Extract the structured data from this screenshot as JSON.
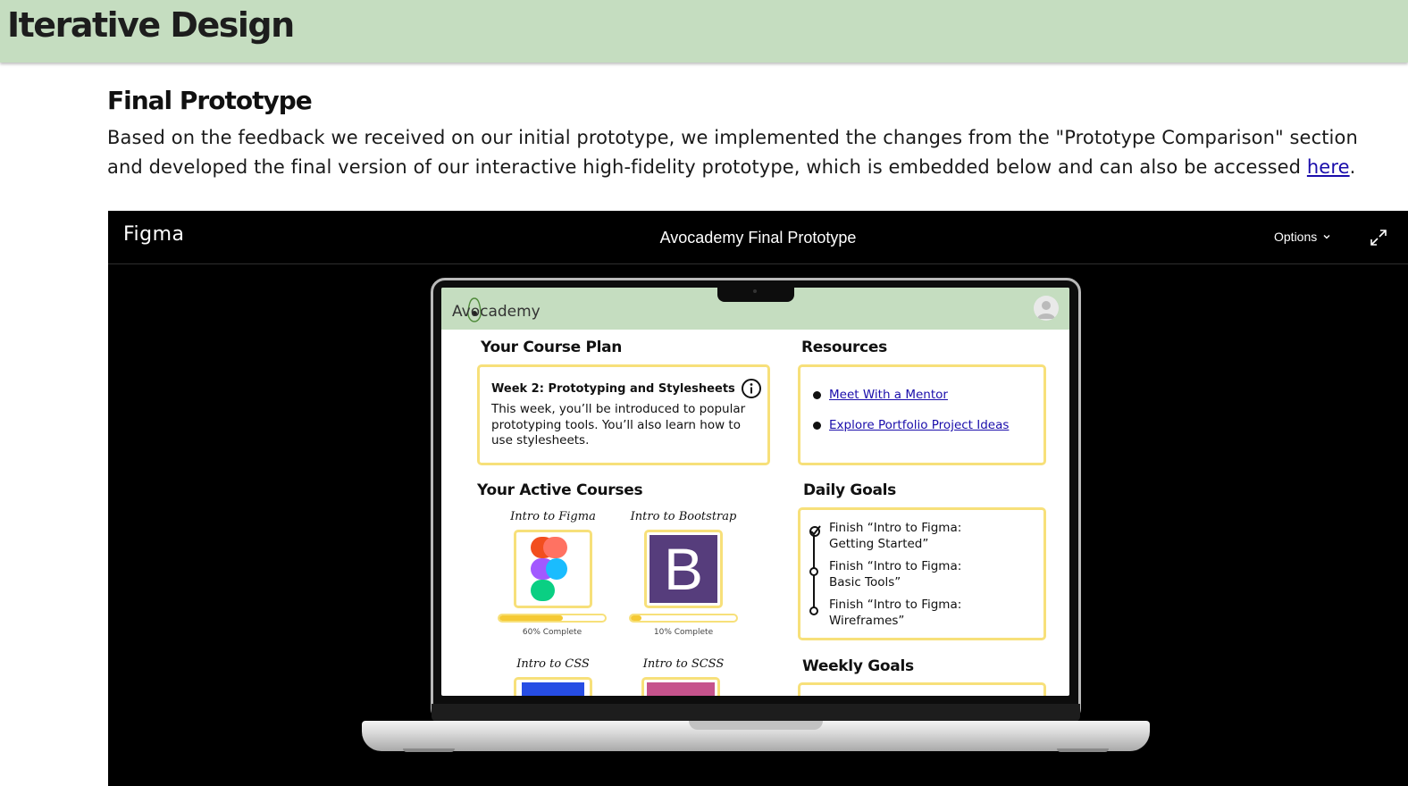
{
  "site": {
    "title": "Iterative Design"
  },
  "section": {
    "heading": "Final Prototype",
    "body_before_link": "Based on the feedback we received on our initial prototype, we implemented the changes from the \"Prototype Comparison\" section and developed the final version of our interactive high-fidelity prototype, which is embedded below and can also be accessed ",
    "link_text": "here",
    "body_after_link": "."
  },
  "embed": {
    "brand": "Figma",
    "title": "Avocademy Final Prototype",
    "options_label": "Options",
    "expand_icon": "expand-icon"
  },
  "app": {
    "logo": "Avocademy",
    "course_plan": {
      "heading": "Your Course Plan",
      "card_title": "Week 2: Prototyping and Stylesheets",
      "card_desc": "This week, you’ll be introduced to popular prototyping tools. You’ll also learn how to use stylesheets."
    },
    "resources": {
      "heading": "Resources",
      "links": [
        "Meet With a Mentor",
        "Explore Portfolio Project Ideas"
      ]
    },
    "active_courses": {
      "heading": "Your Active Courses",
      "courses": [
        {
          "name": "Intro to Figma",
          "progress": 0.6,
          "progress_label": "60% Complete",
          "icon": "figma-icon"
        },
        {
          "name": "Intro to Bootstrap",
          "progress": 0.1,
          "progress_label": "10% Complete",
          "icon": "bootstrap-icon",
          "glyph": "B"
        },
        {
          "name": "Intro to CSS",
          "icon": "css-icon"
        },
        {
          "name": "Intro to SCSS",
          "icon": "scss-icon"
        }
      ]
    },
    "daily_goals": {
      "heading": "Daily Goals",
      "goals": [
        {
          "text": "Finish “Intro to Figma: Getting Started”",
          "done": true
        },
        {
          "text": "Finish “Intro to Figma: Basic Tools”",
          "done": false
        },
        {
          "text": "Finish “Intro to Figma: Wireframes”",
          "done": false
        }
      ]
    },
    "weekly_goals": {
      "heading": "Weekly Goals"
    }
  },
  "colors": {
    "header_green": "#c5ddc0",
    "card_border": "#f7e07a",
    "progress_fill": "#f5c934",
    "bootstrap_purple": "#563d7c",
    "link": "#1a0dab"
  }
}
